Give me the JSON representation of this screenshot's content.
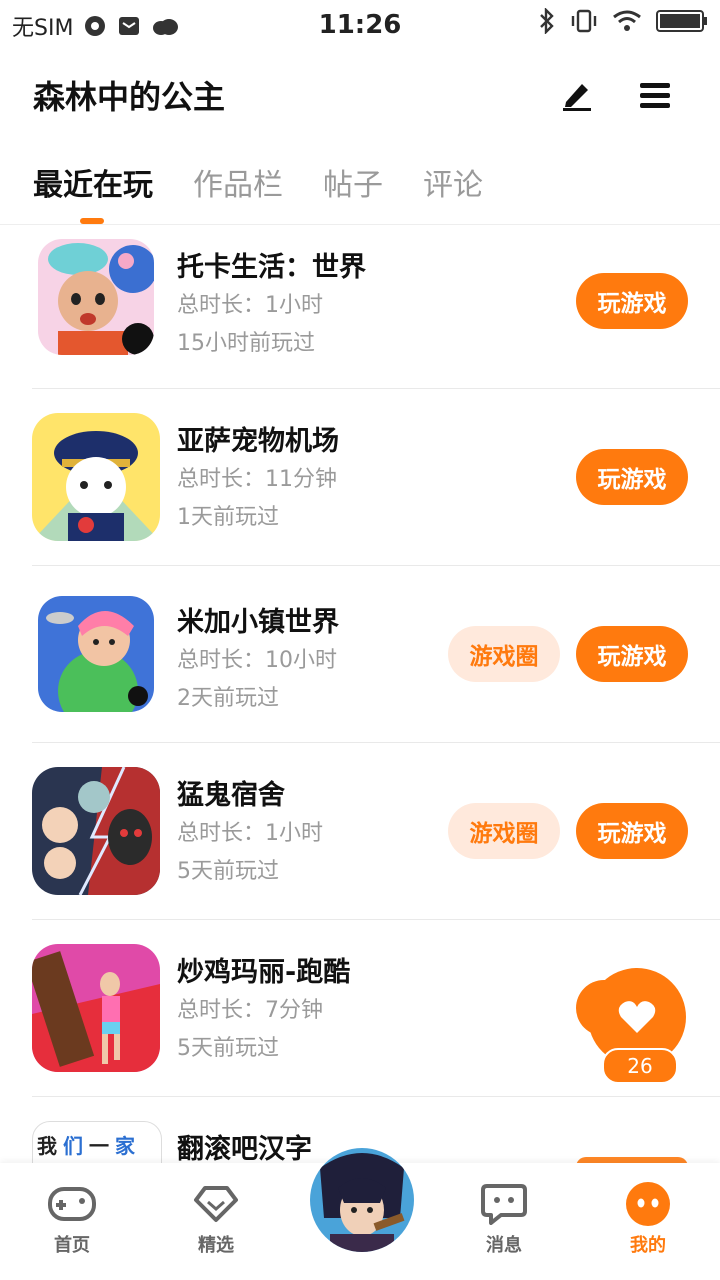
{
  "status_bar": {
    "carrier": "无SIM",
    "time": "11:26"
  },
  "header": {
    "title": "森林中的公主",
    "edit_icon": "pen-icon",
    "menu_icon": "hamburger-menu-icon"
  },
  "tabs": [
    "最近在玩",
    "作品栏",
    "帖子",
    "评论"
  ],
  "games": [
    {
      "name": "托卡生活：世界",
      "duration": "总时长：1小时",
      "last_played": "15小时前玩过",
      "play_label": "玩游戏"
    },
    {
      "name": "亚萨宠物机场",
      "duration": "总时长：11分钟",
      "last_played": "1天前玩过",
      "play_label": "玩游戏"
    },
    {
      "name": "米加小镇世界",
      "duration": "总时长：10小时",
      "last_played": "2天前玩过",
      "play_label": "玩游戏",
      "circle_label": "游戏圈"
    },
    {
      "name": "猛鬼宿舍",
      "duration": "总时长：1小时",
      "last_played": "5天前玩过",
      "play_label": "玩游戏",
      "circle_label": "游戏圈"
    },
    {
      "name": "炒鸡玛丽-跑酷",
      "duration": "总时长：7分钟",
      "last_played": "5天前玩过"
    },
    {
      "name": "翻滚吧汉字"
    }
  ],
  "hanzi_icon_chars": [
    "我",
    "们",
    "一",
    "家"
  ],
  "like": {
    "count": "26"
  },
  "bottom_nav": {
    "home": "首页",
    "featured": "精选",
    "messages": "消息",
    "mine": "我的"
  },
  "colors": {
    "accent": "#ff7a0e",
    "accent_light": "#ffe9dc",
    "muted_text": "#9a9a9a"
  }
}
